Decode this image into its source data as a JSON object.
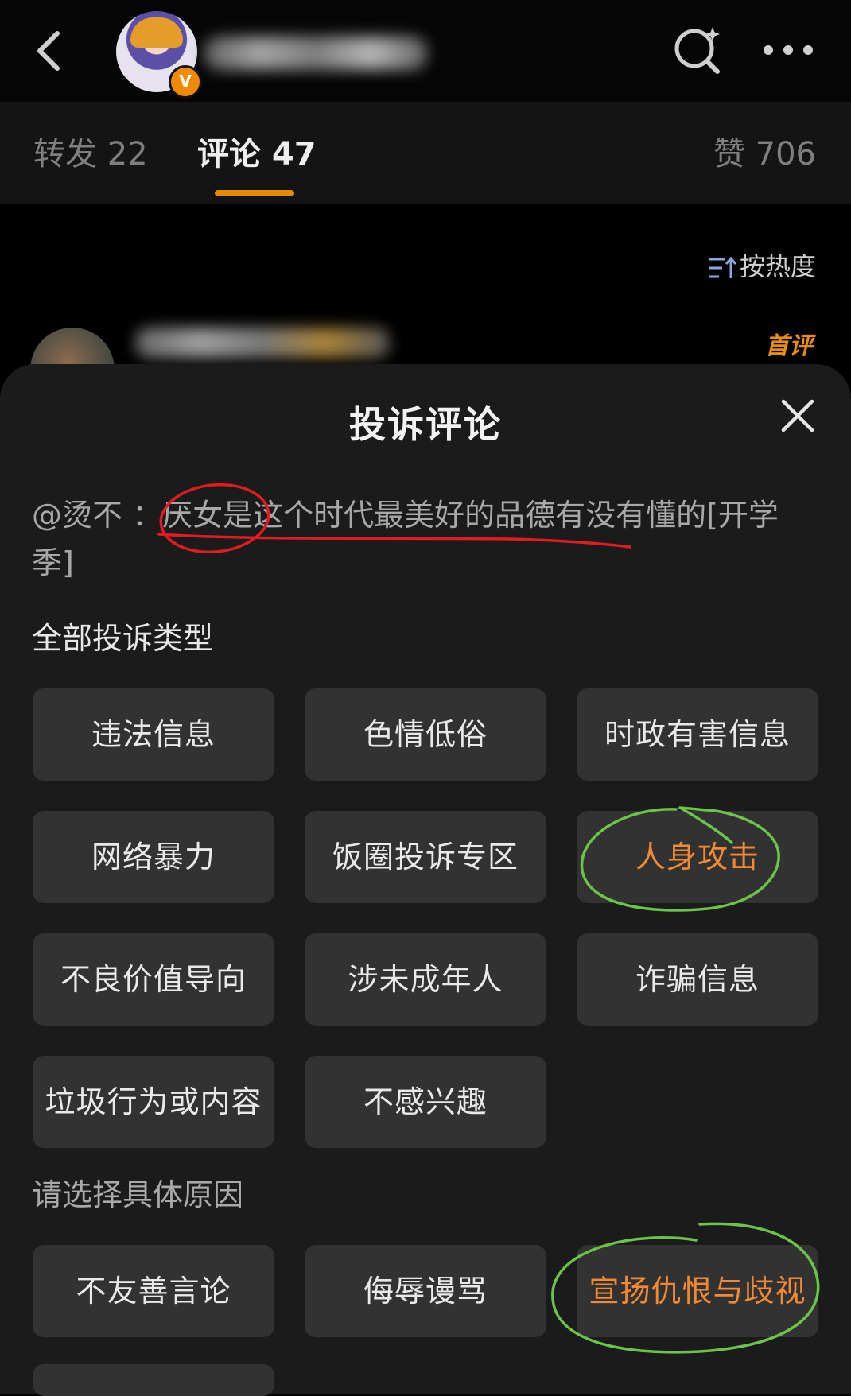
{
  "header": {
    "back_icon": "chevron-left-icon",
    "verified_badge": "V",
    "search_icon": "search-sparkle-icon",
    "more_icon": "more-dots-icon"
  },
  "tabs": [
    {
      "label": "转发 22"
    },
    {
      "label": "评论 47"
    },
    {
      "label": "赞 706"
    }
  ],
  "sort": {
    "label": "按热度",
    "icon": "sort-icon"
  },
  "comment_preview": {
    "badge": "首评"
  },
  "sheet": {
    "title": "投诉评论",
    "close_icon": "close-icon",
    "quote": "@烫不   ：厌女是这个时代最美好的品德有没有懂的[开学季]",
    "all_types_label": "全部投诉类型",
    "types": [
      {
        "label": "违法信息",
        "selected": false
      },
      {
        "label": "色情低俗",
        "selected": false
      },
      {
        "label": "时政有害信息",
        "selected": false
      },
      {
        "label": "网络暴力",
        "selected": false
      },
      {
        "label": "饭圈投诉专区",
        "selected": false
      },
      {
        "label": "人身攻击",
        "selected": true
      },
      {
        "label": "不良价值导向",
        "selected": false
      },
      {
        "label": "涉未成年人",
        "selected": false
      },
      {
        "label": "诈骗信息",
        "selected": false
      },
      {
        "label": "垃圾行为或内容",
        "selected": false
      },
      {
        "label": "不感兴趣",
        "selected": false
      }
    ],
    "reason_label": "请选择具体原因",
    "reasons": [
      {
        "label": "不友善言论",
        "selected": false
      },
      {
        "label": "侮辱谩骂",
        "selected": false
      },
      {
        "label": "宣扬仇恨与歧视",
        "selected": true
      }
    ]
  },
  "colors": {
    "accent_orange": "#f08a34",
    "annotation_red": "#e01b24",
    "annotation_green": "#6cc24a"
  }
}
